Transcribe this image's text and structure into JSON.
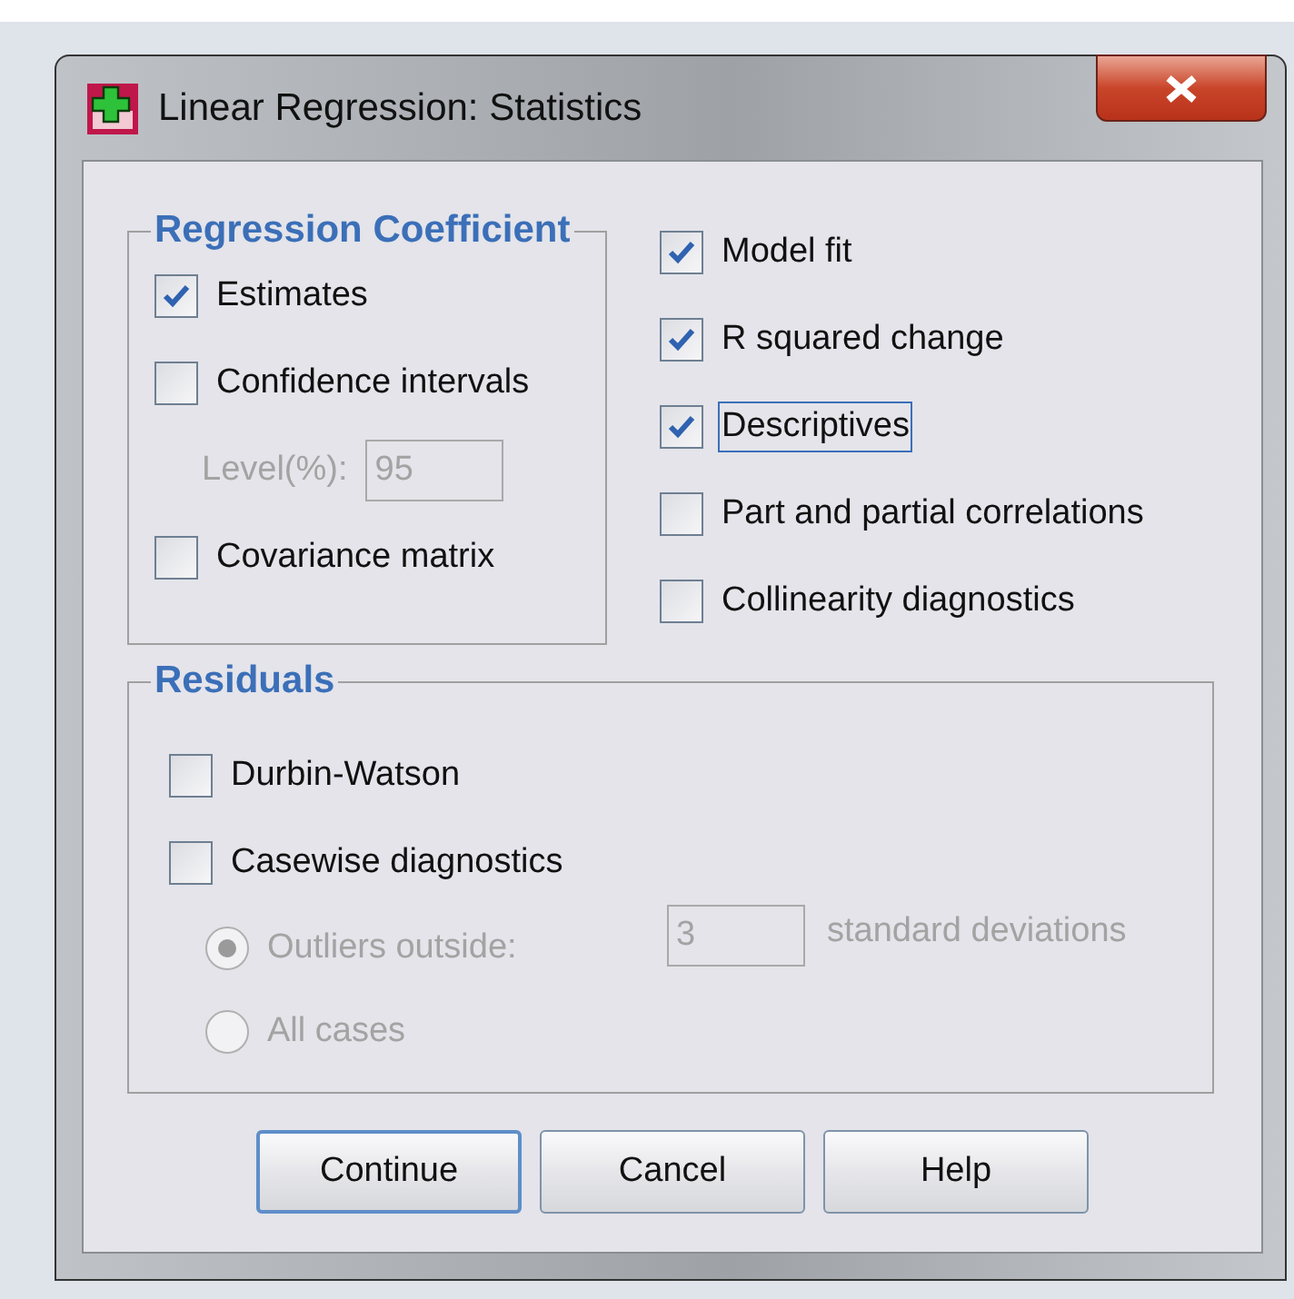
{
  "window": {
    "title": "Linear Regression: Statistics"
  },
  "regression_coefficient": {
    "title": "Regression Coefficient",
    "items": [
      {
        "kind": "checkbox",
        "label": "Estimates",
        "checked": true
      },
      {
        "kind": "checkbox",
        "label": "Confidence intervals",
        "checked": false
      },
      {
        "kind": "field",
        "label": "Level(%):",
        "value": "95",
        "disabled": true
      },
      {
        "kind": "checkbox",
        "label": "Covariance matrix",
        "checked": false
      }
    ]
  },
  "options": [
    {
      "label": "Model fit",
      "checked": true,
      "focused": false
    },
    {
      "label": "R squared change",
      "checked": true,
      "focused": false
    },
    {
      "label": "Descriptives",
      "checked": true,
      "focused": true
    },
    {
      "label": "Part and partial correlations",
      "checked": false,
      "focused": false
    },
    {
      "label": "Collinearity diagnostics",
      "checked": false,
      "focused": false
    }
  ],
  "residuals": {
    "title": "Residuals",
    "checks": [
      {
        "label": "Durbin-Watson",
        "checked": false
      },
      {
        "label": "Casewise diagnostics",
        "checked": false
      }
    ],
    "radios": [
      {
        "label": "Outliers outside:",
        "selected": true,
        "disabled": true
      },
      {
        "label": "All cases",
        "selected": false,
        "disabled": true
      }
    ],
    "outliers_field": {
      "value": "3",
      "suffix": "standard deviations",
      "disabled": true
    }
  },
  "buttons": [
    {
      "label": "Continue",
      "default": true
    },
    {
      "label": "Cancel",
      "default": false
    },
    {
      "label": "Help",
      "default": false
    }
  ]
}
